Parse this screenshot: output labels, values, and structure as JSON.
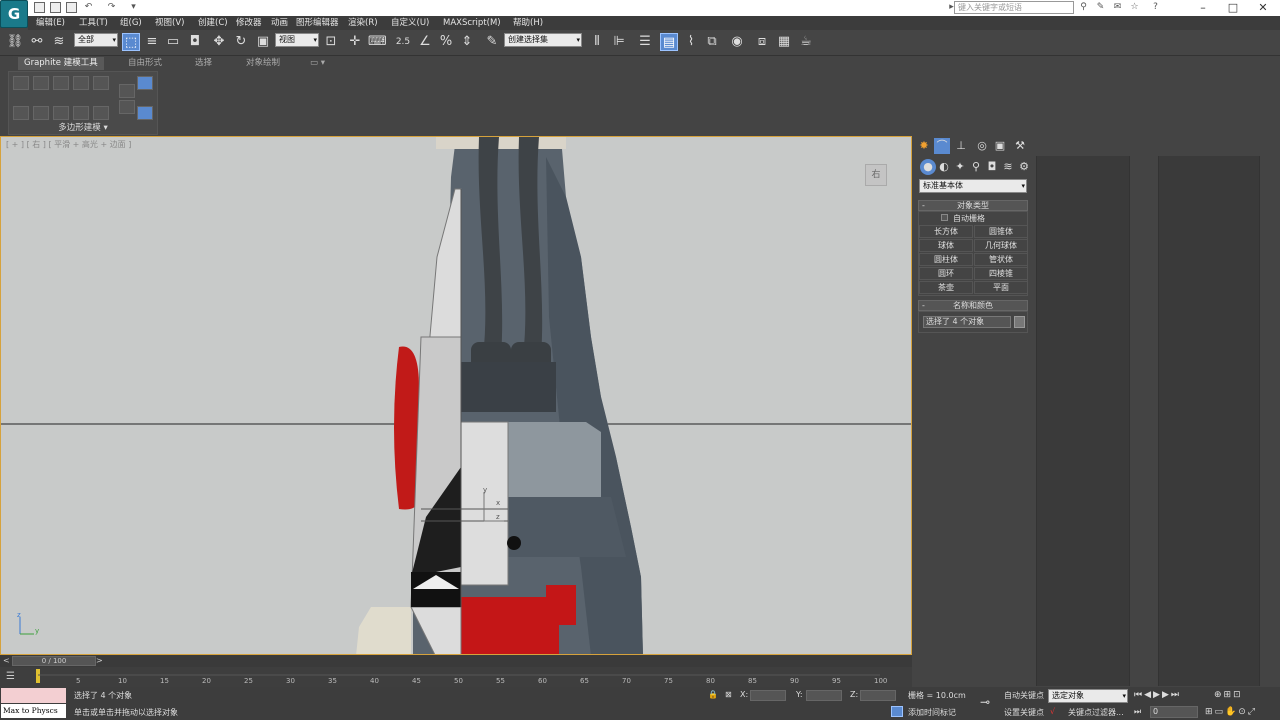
{
  "quick_access": {
    "workspace_label": "工作台"
  },
  "search": {
    "placeholder": "键入关键字或短语"
  },
  "menus": [
    "编辑(E)",
    "工具(T)",
    "组(G)",
    "视图(V)",
    "创建(C)",
    "修改器",
    "动画",
    "图形编辑器",
    "渲染(R)",
    "自定义(U)",
    "MAXScript(M)",
    "帮助(H)"
  ],
  "toolbar": {
    "selection_filter": "全部",
    "ref_coord": "视图",
    "snap_percent": "2.5",
    "named_selection": "创建选择集"
  },
  "ribbon": {
    "tabs": [
      "Graphite 建模工具",
      "自由形式",
      "选择",
      "对象绘制"
    ],
    "panel_label": "多边形建模"
  },
  "viewport": {
    "label": "[ + ] [ 右 ] [ 平滑 + 高光 + 边面 ]",
    "viewcube_label": "右",
    "axes": {
      "x": "x",
      "y": "y",
      "z": "z"
    }
  },
  "command_panel": {
    "category": "标准基本体",
    "object_type_title": "对象类型",
    "autogrid_label": "自动栅格",
    "buttons": [
      "长方体",
      "圆锥体",
      "球体",
      "几何球体",
      "圆柱体",
      "管状体",
      "圆环",
      "四棱锥",
      "茶壶",
      "平面"
    ],
    "name_color_title": "名称和颜色",
    "name_value": "选择了 4 个对象"
  },
  "timeline": {
    "frame_display": "0 / 100",
    "ticks": [
      "0",
      "5",
      "10",
      "15",
      "20",
      "25",
      "30",
      "35",
      "40",
      "45",
      "50",
      "55",
      "60",
      "65",
      "70",
      "75",
      "80",
      "85",
      "90",
      "95",
      "100"
    ]
  },
  "status": {
    "maxscript_label": "Max to Physcs",
    "selected_text": "选择了 4 个对象",
    "prompt_text": "单击或单击并拖动以选择对象",
    "x_label": "X:",
    "y_label": "Y:",
    "z_label": "Z:",
    "grid_text": "栅格 = 10.0cm",
    "add_time_tag": "添加时间标记",
    "auto_key": "自动关键点",
    "set_key": "设置关键点",
    "key_filter_select": "选定对象",
    "key_filters": "关键点过滤器...",
    "frame_input": "0"
  },
  "colors": {
    "accent_blue": "#5a8ad0",
    "viewport_border": "#d6a23c",
    "app_icon": "#1a7a8a"
  }
}
